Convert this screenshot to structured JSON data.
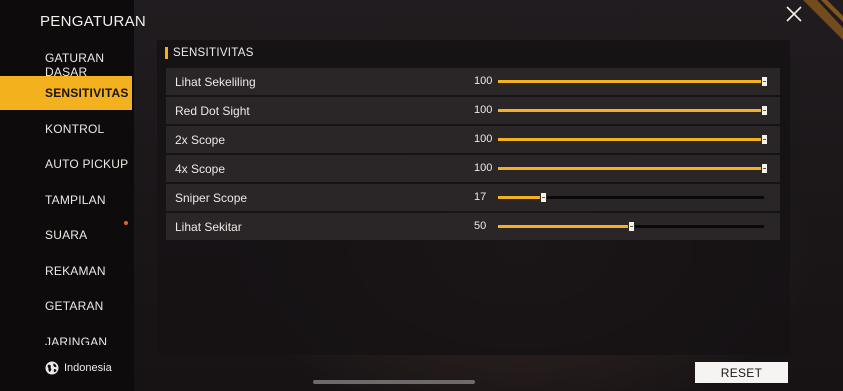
{
  "sidebar": {
    "title": "PENGATURAN",
    "items": [
      {
        "label": "GATURAN DASAR",
        "active": false
      },
      {
        "label": "SENSITIVITAS",
        "active": true
      },
      {
        "label": "KONTROL",
        "active": false
      },
      {
        "label": "AUTO PICKUP",
        "active": false
      },
      {
        "label": "TAMPILAN",
        "active": false
      },
      {
        "label": "SUARA",
        "active": false
      },
      {
        "label": "REKAMAN",
        "active": false
      },
      {
        "label": "GETARAN",
        "active": false
      },
      {
        "label": "JARINGAN",
        "active": false
      }
    ],
    "language": {
      "label": "Indonesia",
      "icon": "globe-icon"
    }
  },
  "section": {
    "title": "SENSITIVITAS"
  },
  "sliders": [
    {
      "label": "Lihat Sekeliling",
      "value": "100",
      "level": 100,
      "max": 100
    },
    {
      "label": "Red Dot Sight",
      "value": "100",
      "level": 100,
      "max": 100
    },
    {
      "label": "2x Scope",
      "value": "100",
      "level": 100,
      "max": 100
    },
    {
      "label": "4x Scope",
      "value": "100",
      "level": 100,
      "max": 100
    },
    {
      "label": "Sniper Scope",
      "value": "17",
      "level": 17,
      "max": 100
    },
    {
      "label": "Lihat Sekitar",
      "value": "50",
      "level": 50,
      "max": 100
    }
  ],
  "buttons": {
    "reset_label": "RESET",
    "close_icon": "close-icon"
  },
  "colors": {
    "accent": "#f4b11e",
    "track": "#0a0909",
    "row_bg": "#2a2628"
  }
}
